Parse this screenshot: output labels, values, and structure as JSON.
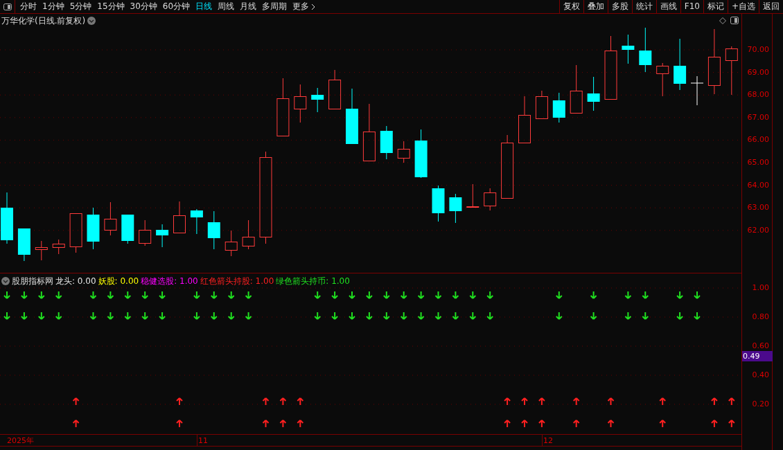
{
  "toolbar": {
    "periods": [
      {
        "label": "分时",
        "selected": false
      },
      {
        "label": "1分钟",
        "selected": false
      },
      {
        "label": "5分钟",
        "selected": false
      },
      {
        "label": "15分钟",
        "selected": false
      },
      {
        "label": "30分钟",
        "selected": false
      },
      {
        "label": "60分钟",
        "selected": false
      },
      {
        "label": "日线",
        "selected": true
      },
      {
        "label": "周线",
        "selected": false
      },
      {
        "label": "月线",
        "selected": false
      },
      {
        "label": "多周期",
        "selected": false
      }
    ],
    "more": "更多",
    "actions": [
      "复权",
      "叠加",
      "多股",
      "统计",
      "画线",
      "F10",
      "标记",
      "+自选",
      "返回"
    ]
  },
  "price_panel": {
    "title": "万华化学(日线.前复权)",
    "axis_labels": [
      "70.00",
      "69.00",
      "68.00",
      "67.00",
      "66.00",
      "65.00",
      "64.00",
      "63.00",
      "62.00"
    ]
  },
  "indicator_panel": {
    "name": "股朋指标网",
    "values": [
      {
        "label": "龙头:",
        "value": "0.00",
        "color": "#e6e6e6"
      },
      {
        "label": "妖股:",
        "value": "0.00",
        "color": "#ffff00"
      },
      {
        "label": "稳健选股:",
        "value": "1.00",
        "color": "#ff00ff"
      },
      {
        "label": "红色箭头持股:",
        "value": "1.00",
        "color": "#ff2020"
      },
      {
        "label": "绿色箭头持币:",
        "value": "1.00",
        "color": "#20e020"
      }
    ],
    "axis_labels": [
      "1.00",
      "0.80",
      "0.60",
      "0.40",
      "0.20"
    ],
    "current_value": "0.49"
  },
  "time_axis": {
    "labels": [
      "2025年",
      "11",
      "12"
    ]
  }
}
